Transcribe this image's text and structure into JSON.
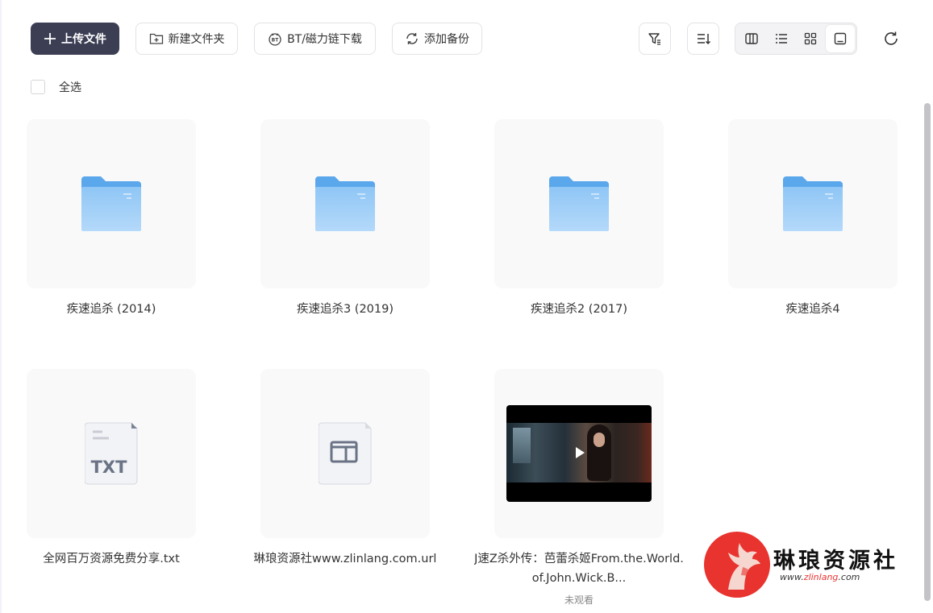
{
  "toolbar": {
    "upload_label": "上传文件",
    "new_folder_label": "新建文件夹",
    "bt_label": "BT/磁力链下载",
    "backup_label": "添加备份"
  },
  "select_all": {
    "label": "全选"
  },
  "files": [
    {
      "name": "疾速追杀 (2014)",
      "type": "folder"
    },
    {
      "name": "疾速追杀3 (2019)",
      "type": "folder"
    },
    {
      "name": "疾速追杀2 (2017)",
      "type": "folder"
    },
    {
      "name": "疾速追杀4",
      "type": "folder"
    },
    {
      "name": "全网百万资源免费分享.txt",
      "type": "txt"
    },
    {
      "name": "琳琅资源社www.zlinlang.com.url",
      "type": "url"
    },
    {
      "name": "J速Z杀外传：芭蕾杀姬From.the.World.of.John.Wick.B...",
      "type": "video",
      "status": "未观看"
    }
  ],
  "icons": {
    "txt_label": "TXT"
  },
  "watermark": {
    "title": "琳琅资源社",
    "url_prefix": "www.",
    "url_brand": "zlinlang",
    "url_suffix": ".com"
  },
  "colors": {
    "primary": "#3c3f54",
    "folder": "#6eb3f0",
    "brand_red": "#e8332f"
  }
}
